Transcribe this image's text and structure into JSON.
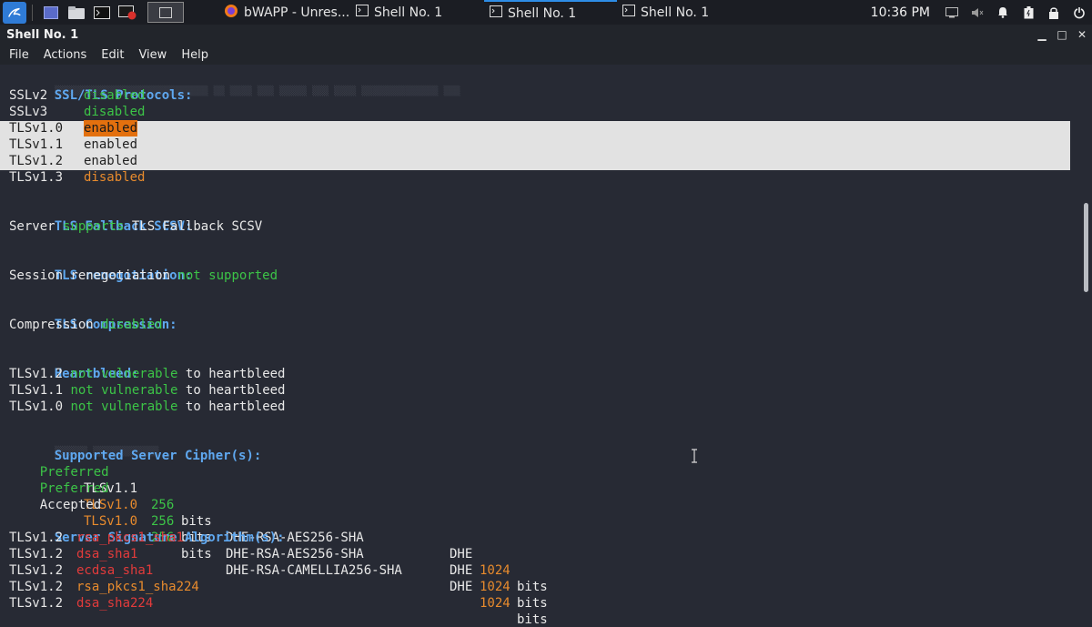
{
  "taskbar": {
    "tasks": [
      {
        "label": "bWAPP - Unres...",
        "icon": "firefox-icon",
        "active": false
      },
      {
        "label": "Shell No. 1",
        "icon": "terminal-icon",
        "active": false
      },
      {
        "label": "Shell No. 1",
        "icon": "terminal-icon",
        "active": true
      },
      {
        "label": "Shell No. 1",
        "icon": "terminal-icon",
        "active": false
      }
    ],
    "clock": "10:36 PM"
  },
  "window": {
    "title": "Shell No. 1",
    "menu": [
      "File",
      "Actions",
      "Edit",
      "View",
      "Help"
    ]
  },
  "colors": {
    "header": "#5fa8f0",
    "green": "#3cc447",
    "orange": "#e88b2d",
    "red": "#e23b3b",
    "highlight": "#e2e2e2",
    "background": "#272a34"
  },
  "terminal": {
    "sections": {
      "protocols": {
        "header": "SSL/TLS Protocols:",
        "rows": [
          {
            "name": "SSLv2",
            "status": "disabled"
          },
          {
            "name": "SSLv3",
            "status": "disabled"
          },
          {
            "name": "TLSv1.0",
            "status": "enabled"
          },
          {
            "name": "TLSv1.1",
            "status": "enabled"
          },
          {
            "name": "TLSv1.2",
            "status": "enabled"
          },
          {
            "name": "TLSv1.3",
            "status": "disabled"
          }
        ]
      },
      "fallback": {
        "header": "TLS Fallback SCSV:",
        "pre": "Server",
        "status": "supports",
        "post": "TLS Fallback SCSV"
      },
      "renegotiation": {
        "header": "TLS renegotiation:",
        "pre": "Session renegotiation",
        "status": "not supported"
      },
      "compression": {
        "header": "TLS Compression:",
        "pre": "Compression",
        "status": "disabled"
      },
      "heartbleed": {
        "header": "Heartbleed:",
        "rows": [
          {
            "proto": "TLSv1.2",
            "status": "not vulnerable",
            "post": "to heartbleed"
          },
          {
            "proto": "TLSv1.1",
            "status": "not vulnerable",
            "post": "to heartbleed"
          },
          {
            "proto": "TLSv1.0",
            "status": "not vulnerable",
            "post": "to heartbleed"
          }
        ]
      },
      "ciphers": {
        "header": "Supported Server Cipher(s):",
        "rows": [
          {
            "kind": "Preferred",
            "proto": "TLSv1.1",
            "bits": "256",
            "unit": "bits",
            "cipher": "DHE-RSA-AES256-SHA",
            "kx": "DHE",
            "kxbits": "1024",
            "kxunit": "bits"
          },
          {
            "kind": "Preferred",
            "proto": "TLSv1.0",
            "bits": "256",
            "unit": "bits",
            "cipher": "DHE-RSA-AES256-SHA",
            "kx": "DHE",
            "kxbits": "1024",
            "kxunit": "bits"
          },
          {
            "kind": "Accepted",
            "proto": "TLSv1.0",
            "bits": "256",
            "unit": "bits",
            "cipher": "DHE-RSA-CAMELLIA256-SHA",
            "kx": "DHE",
            "kxbits": "1024",
            "kxunit": "bits"
          }
        ]
      },
      "signatures": {
        "header": "Server Signature Algorithm(s):",
        "rows": [
          {
            "proto": "TLSv1.2",
            "alg": "rsa_pkcs1_sha1"
          },
          {
            "proto": "TLSv1.2",
            "alg": "dsa_sha1"
          },
          {
            "proto": "TLSv1.2",
            "alg": "ecdsa_sha1"
          },
          {
            "proto": "TLSv1.2",
            "alg": "rsa_pkcs1_sha224"
          },
          {
            "proto": "TLSv1.2",
            "alg": "dsa_sha224"
          }
        ]
      }
    }
  }
}
